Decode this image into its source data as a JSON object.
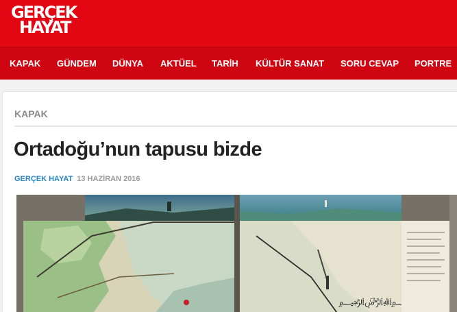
{
  "site": {
    "logo_line1": "GERÇEK",
    "logo_line2": "HAYAT"
  },
  "nav": {
    "items": [
      {
        "label": "KAPAK"
      },
      {
        "label": "GÜNDEM"
      },
      {
        "label": "DÜNYA"
      },
      {
        "label": "AKTÜEL"
      },
      {
        "label": "TARİH"
      },
      {
        "label": "KÜLTÜR SANAT"
      },
      {
        "label": "SORU CEVAP"
      },
      {
        "label": "PORTRE"
      }
    ]
  },
  "article": {
    "category": "KAPAK",
    "title": "Ortadoğu’nun tapusu bizde",
    "author": "GERÇEK HAYAT",
    "date": "13 HAZİRAN 2016"
  },
  "colors": {
    "brand_red": "#e30613",
    "author_blue": "#2a87c7"
  }
}
